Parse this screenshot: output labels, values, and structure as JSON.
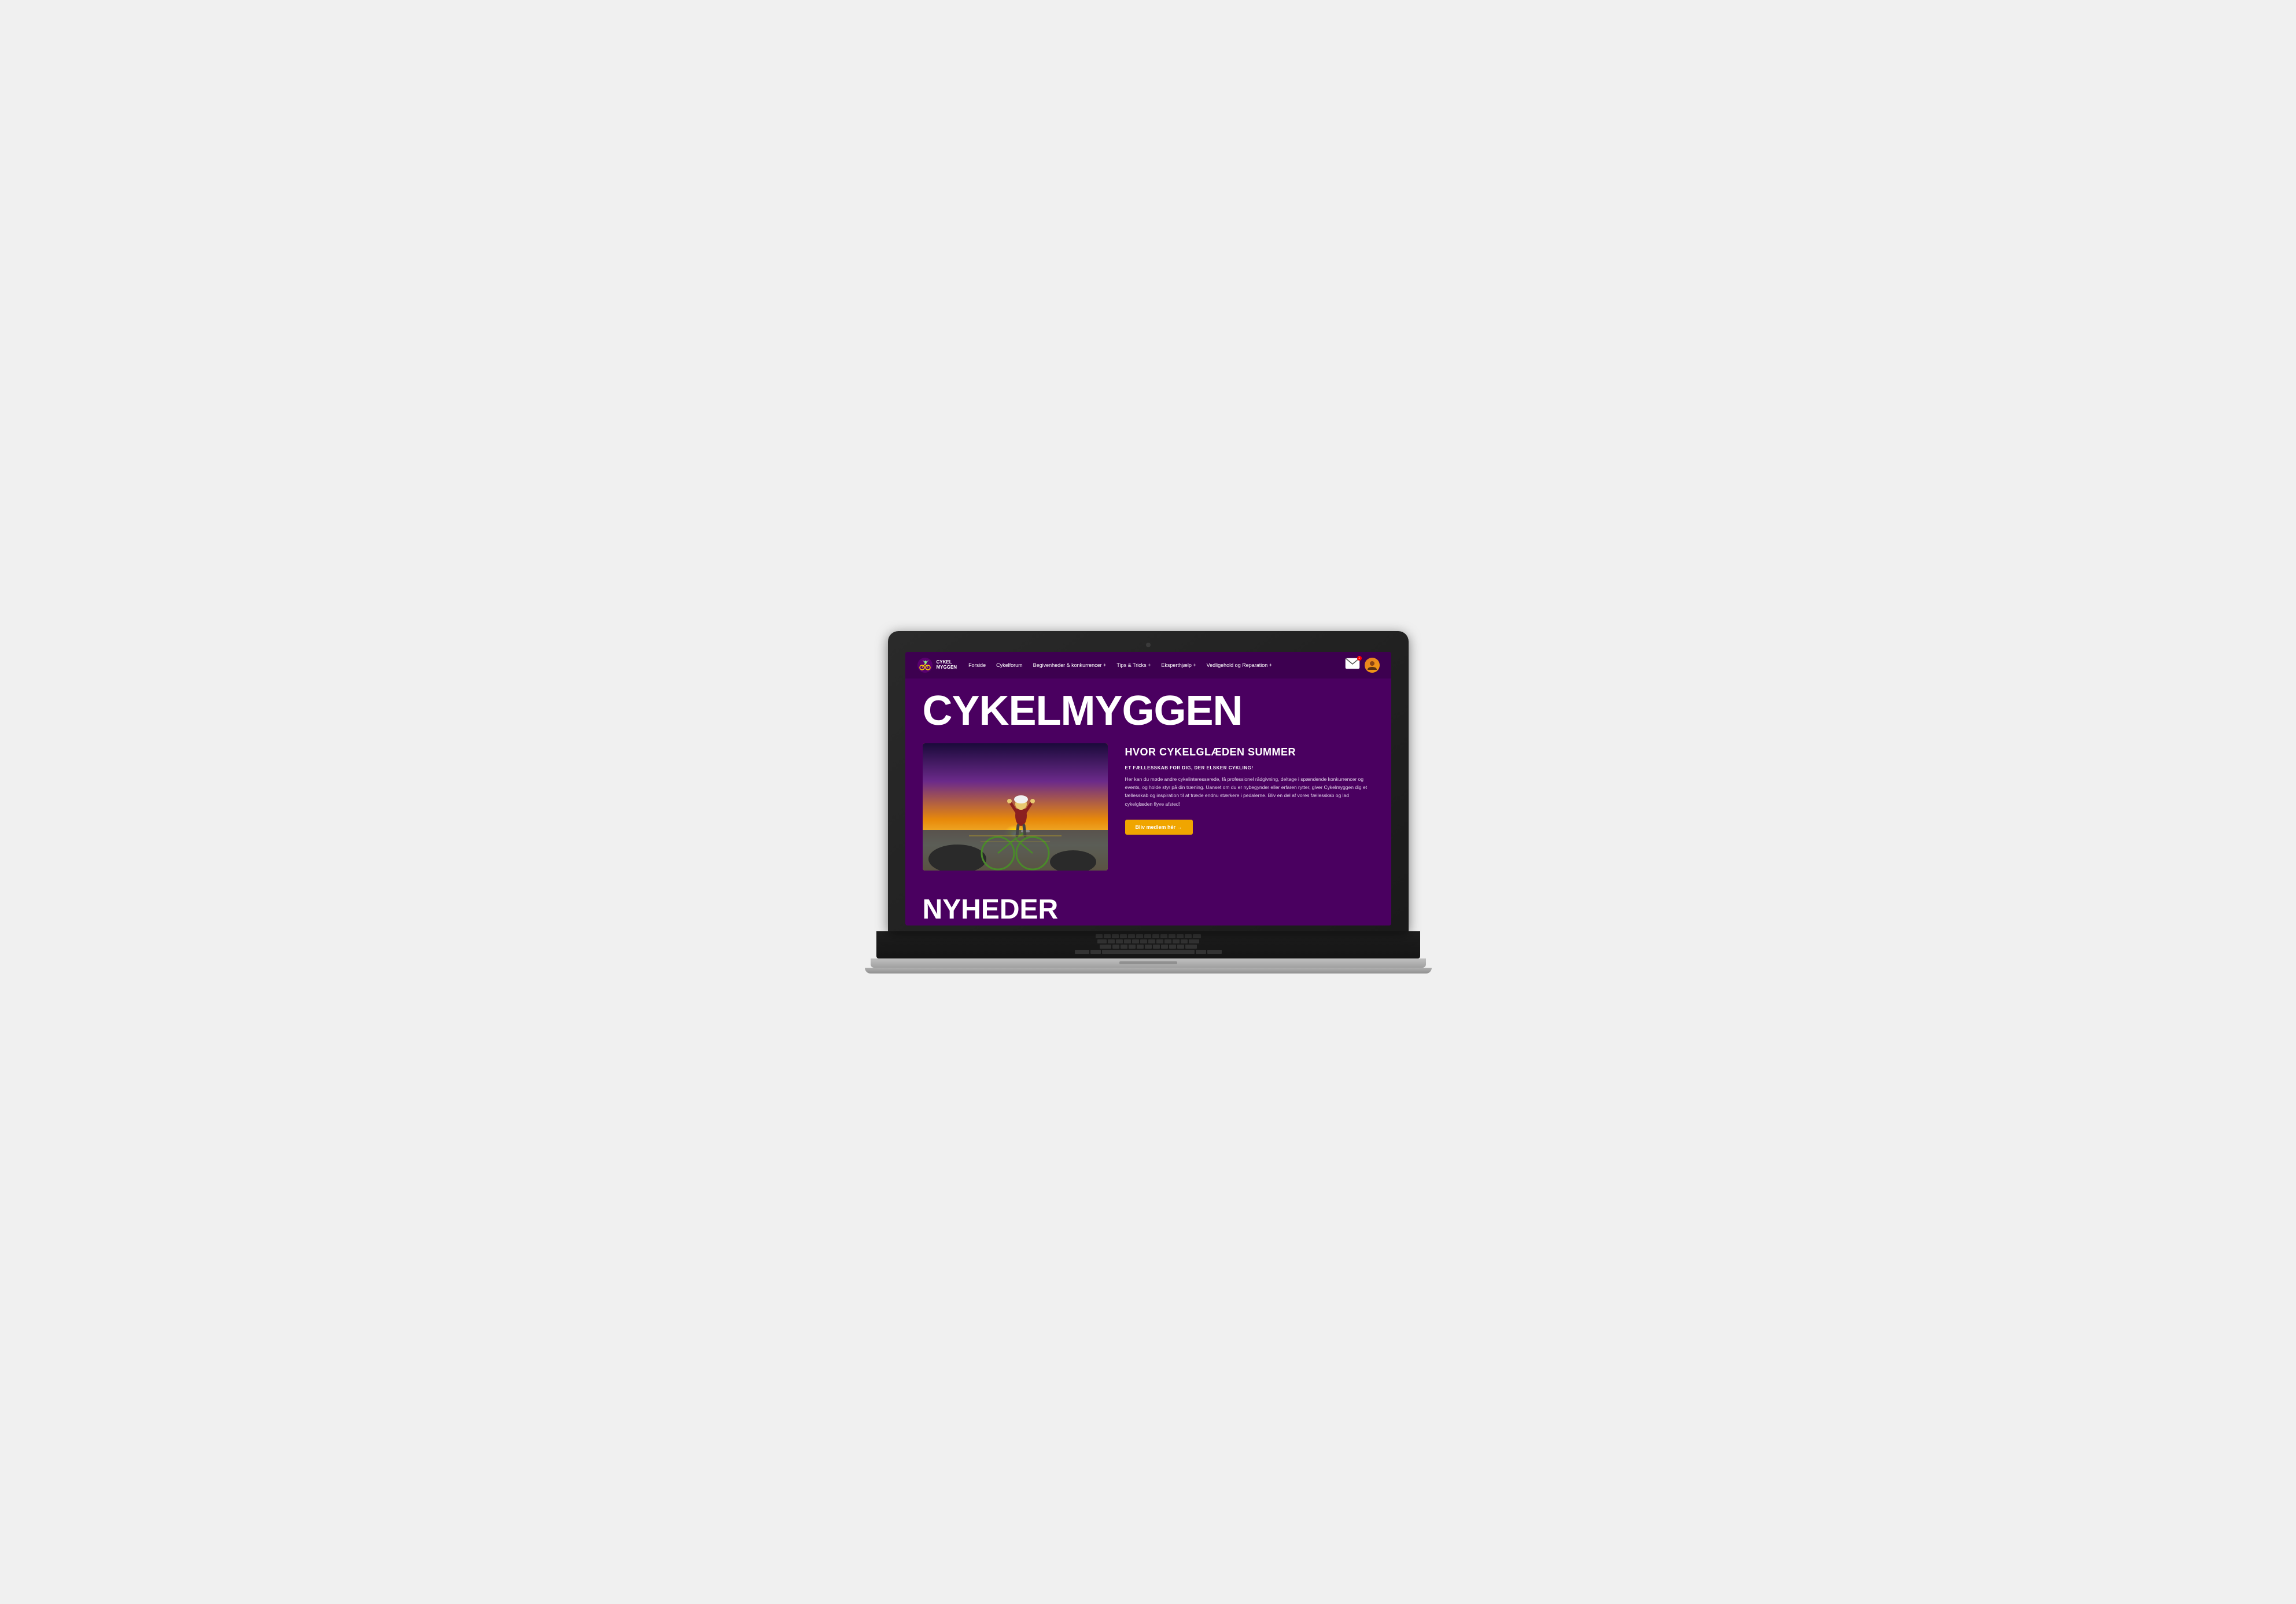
{
  "browser": {
    "title": "Cykelmyggen"
  },
  "nav": {
    "logo_text_line1": "CYKEL",
    "logo_text_line2": "MYGGEN",
    "links": [
      {
        "label": "Forside",
        "has_dropdown": false
      },
      {
        "label": "Cykelforum",
        "has_dropdown": false
      },
      {
        "label": "Begivenheder & konkurrencer +",
        "has_dropdown": true
      },
      {
        "label": "Tips & Tricks +",
        "has_dropdown": true
      },
      {
        "label": "Eksperthjælp +",
        "has_dropdown": true
      },
      {
        "label": "Vedligehold og Reparation +",
        "has_dropdown": true
      }
    ]
  },
  "hero": {
    "main_title": "CYKELMYGGEN",
    "subtitle": "HVOR CYKELGLÆDEN SUMMER",
    "eyebrow": "ET FÆLLESSKAB FOR DIG, DER ELSKER CYKLING!",
    "body_text": "Her kan du møde andre cykelinteresserede, få professionel rådgivning, deltage i spændende konkurrencer og events, og holde styr på din træning. Uanset om du er nybegynder eller erfaren rytter, giver Cykelmyggen dig et fællesskab og inspiration til at træde endnu stærkere i pedalerne. Bliv en del af vores fællesskab og lad cykelglæden flyve afsted!",
    "cta_label": "Bliv medlem hér →"
  },
  "nyheder": {
    "title": "NYHEDER"
  },
  "colors": {
    "background": "#4a0060",
    "nav_bg": "#3d0050",
    "cta_bg": "#f0a500",
    "text_white": "#ffffff",
    "text_muted": "#e0d0e8"
  }
}
